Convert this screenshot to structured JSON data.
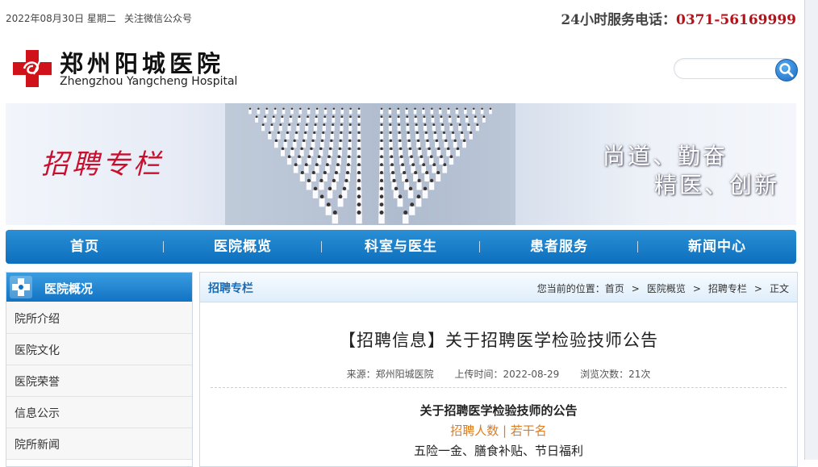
{
  "topbar": {
    "date": "2022年08月30日  星期二",
    "wechat": "关注微信公众号",
    "hotline_label": "24小时服务电话：",
    "hotline_number": "0371-56169999"
  },
  "logo": {
    "name_cn": "郑州阳城医院",
    "name_en": "Zhengzhou Yangcheng Hospital"
  },
  "search": {
    "placeholder": ""
  },
  "banner": {
    "title": "招聘专栏",
    "slogan_line1": "尚道、勤奋",
    "slogan_line2": "精医、创新"
  },
  "nav": {
    "items": [
      "首页",
      "医院概览",
      "科室与医生",
      "患者服务",
      "新闻中心"
    ]
  },
  "sidebar": {
    "title": "医院概况",
    "items": [
      "院所介绍",
      "医院文化",
      "医院荣誉",
      "信息公示",
      "院所新闻"
    ]
  },
  "content": {
    "section_title": "招聘专栏",
    "breadcrumb": {
      "prefix": "您当前的位置：",
      "items": [
        "首页",
        "医院概览",
        "招聘专栏",
        "正文"
      ]
    },
    "article": {
      "title": "【招聘信息】关于招聘医学检验技师公告",
      "source": "来源：郑州阳城医院",
      "upload_time": "上传时间：2022-08-29",
      "views": "浏览次数：21次",
      "body_heading": "关于招聘医学检验技师的公告",
      "body_highlight": "招聘人数  |  若干名",
      "body_benefits": "五险一金、膳食补贴、节日福利"
    }
  },
  "colors": {
    "nav_blue": "#1a7cc8",
    "hotline_red": "#b3141b",
    "banner_title_red": "#c8102e",
    "highlight_orange": "#e07b1e"
  }
}
